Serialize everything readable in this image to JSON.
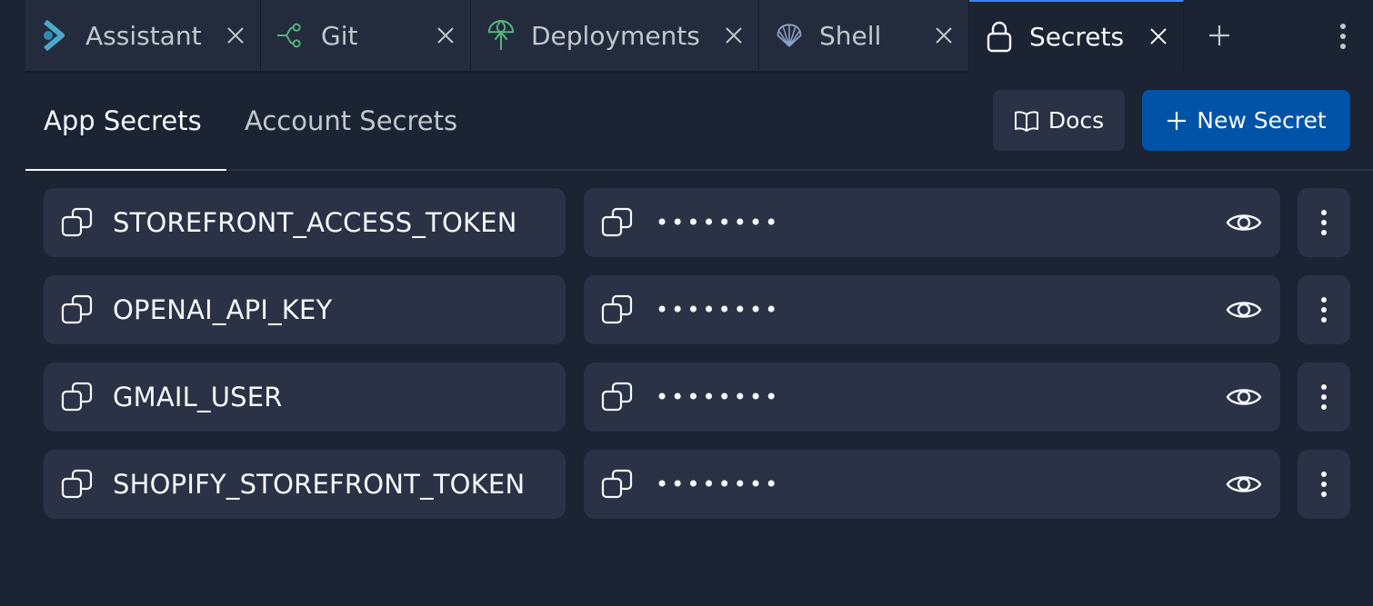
{
  "tabs": [
    {
      "label": "Assistant",
      "icon": "assistant-icon",
      "active": false
    },
    {
      "label": "Git",
      "icon": "git-icon",
      "active": false
    },
    {
      "label": "Deployments",
      "icon": "deployments-icon",
      "active": false
    },
    {
      "label": "Shell",
      "icon": "shell-icon",
      "active": false
    },
    {
      "label": "Secrets",
      "icon": "lock-icon",
      "active": true
    }
  ],
  "subtabs": {
    "app": "App Secrets",
    "account": "Account Secrets"
  },
  "buttons": {
    "docs": "Docs",
    "new_secret": "New Secret"
  },
  "secrets": [
    {
      "key": "STOREFRONT_ACCESS_TOKEN",
      "masked": "••••••••"
    },
    {
      "key": "OPENAI_API_KEY",
      "masked": "••••••••"
    },
    {
      "key": "GMAIL_USER",
      "masked": "••••••••"
    },
    {
      "key": "SHOPIFY_STOREFRONT_TOKEN",
      "masked": "••••••••"
    }
  ],
  "colors": {
    "background": "#1c2333",
    "surface": "#2b3245",
    "accent_blue": "#0053a6",
    "active_tab_border": "#3b83f7",
    "git_green": "#58b37a",
    "assistant_teal": "#4aa9c9"
  }
}
